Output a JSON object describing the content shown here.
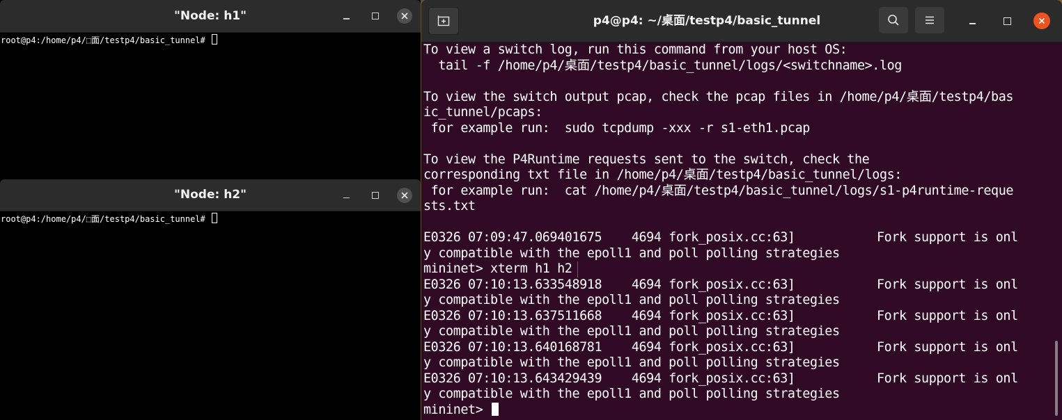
{
  "xterm_h1": {
    "title": "\"Node: h1\"",
    "prompt": "root@p4:/home/p4/⬚面/testp4/basic_tunnel# "
  },
  "xterm_h2": {
    "title": "\"Node: h2\"",
    "prompt": "root@p4:/home/p4/⬚面/testp4/basic_tunnel# "
  },
  "terminal": {
    "title": "p4@p4: ~/桌面/testp4/basic_tunnel",
    "lines": [
      "To view a switch log, run this command from your host OS:",
      "  tail -f /home/p4/桌面/testp4/basic_tunnel/logs/<switchname>.log",
      "",
      "To view the switch output pcap, check the pcap files in /home/p4/桌面/testp4/bas",
      "ic_tunnel/pcaps:",
      " for example run:  sudo tcpdump -xxx -r s1-eth1.pcap",
      "",
      "To view the P4Runtime requests sent to the switch, check the",
      "corresponding txt file in /home/p4/桌面/testp4/basic_tunnel/logs:",
      " for example run:  cat /home/p4/桌面/testp4/basic_tunnel/logs/s1-p4runtime-reque",
      "sts.txt",
      "",
      "E0326 07:09:47.069401675    4694 fork_posix.cc:63]           Fork support is onl",
      "y compatible with the epoll1 and poll polling strategies"
    ],
    "highlighted_command": "mininet> xterm h1 h2",
    "lines_after": [
      "E0326 07:10:13.633548918    4694 fork_posix.cc:63]           Fork support is onl",
      "y compatible with the epoll1 and poll polling strategies",
      "E0326 07:10:13.637511668    4694 fork_posix.cc:63]           Fork support is onl",
      "y compatible with the epoll1 and poll polling strategies",
      "E0326 07:10:13.640168781    4694 fork_posix.cc:63]           Fork support is onl",
      "y compatible with the epoll1 and poll polling strategies",
      "E0326 07:10:13.643429439    4694 fork_posix.cc:63]           Fork support is onl",
      "y compatible with the epoll1 and poll polling strategies"
    ],
    "prompt": "mininet> "
  },
  "icons": {
    "new_tab": "new-tab-icon",
    "search": "search-icon",
    "menu": "hamburger-menu-icon",
    "minimize": "minimize-icon",
    "maximize": "maximize-icon",
    "close": "close-icon"
  },
  "colors": {
    "terminal_bg": "#300a24",
    "close_accent": "#e95420",
    "highlight_box": "#d32f2f"
  }
}
